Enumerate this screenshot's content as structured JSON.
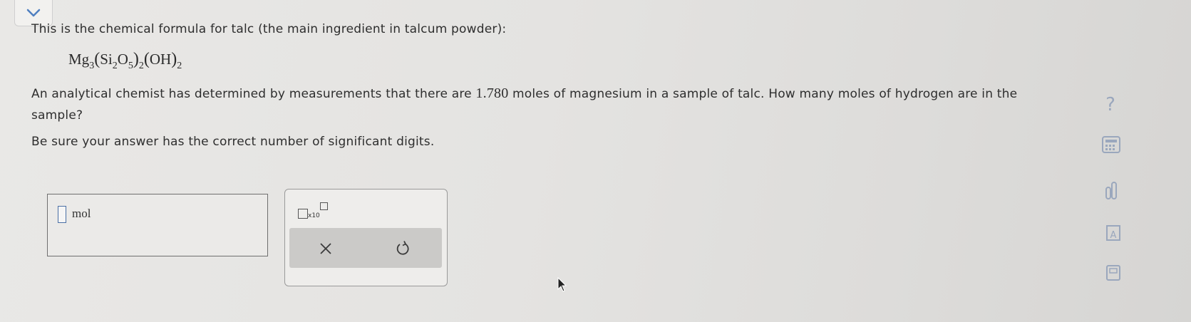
{
  "question": {
    "intro": "This is the chemical formula for talc (the main ingredient in talcum powder):",
    "formula": {
      "mg": "Mg",
      "mg_sub": "3",
      "si": "Si",
      "si_sub": "2",
      "o": "O",
      "o_sub": "5",
      "group_sub": "2",
      "oh": "OH",
      "oh_sub": "2"
    },
    "prompt_before": "An analytical chemist has determined by measurements that there are ",
    "amount": "1.780",
    "prompt_after": " moles of magnesium in a sample of talc. How many moles of hydrogen are in the sample?",
    "note": "Be sure your answer has the correct number of significant digits."
  },
  "answer": {
    "value": "",
    "unit": "mol"
  },
  "tools": {
    "sci_notation_label": "x10",
    "clear_icon": "x-icon",
    "undo_icon": "undo-icon"
  },
  "sidebar": {
    "help_label": "?",
    "icons": [
      "help-icon",
      "calculator-icon",
      "chart-icon",
      "periodic-table-icon",
      "book-icon"
    ]
  },
  "colors": {
    "input_border": "#4a6fa5",
    "chevron": "#4f7fc0",
    "side_icon": "#9aa7bd"
  }
}
